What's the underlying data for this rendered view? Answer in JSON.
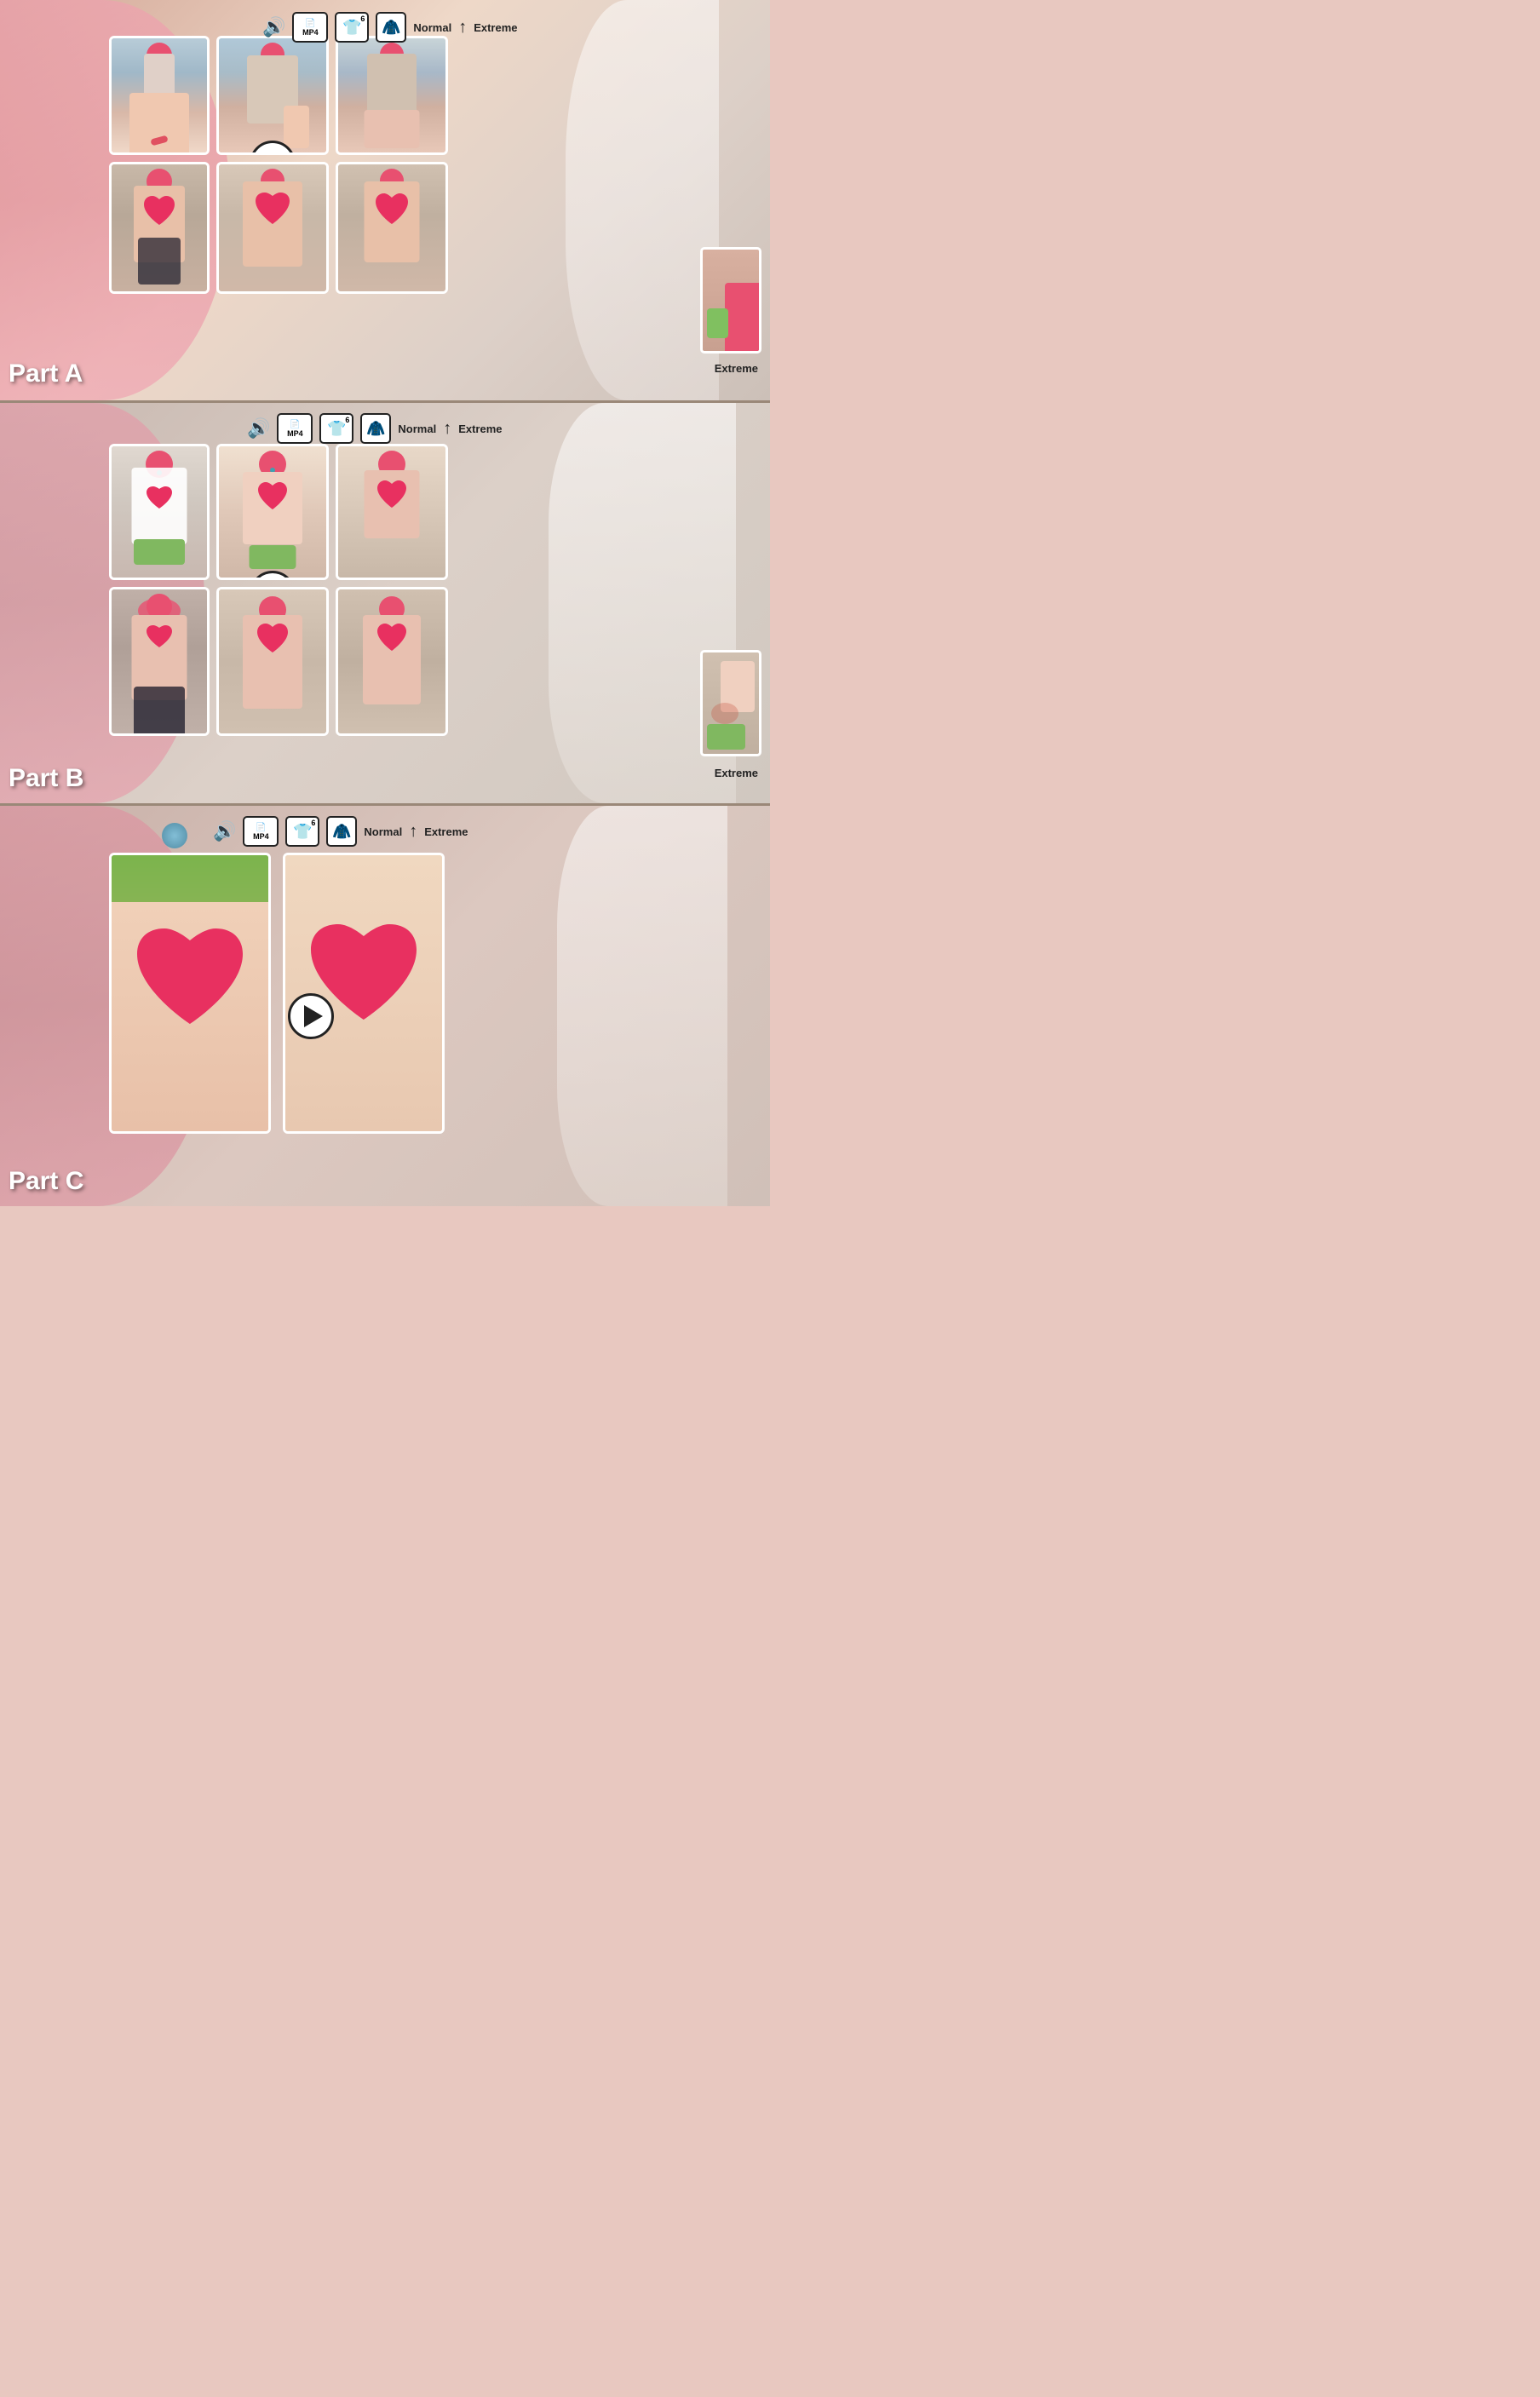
{
  "sections": [
    {
      "id": "part-a",
      "label": "Part A",
      "controls": {
        "sound_label": "🔊",
        "mp4_label": "MP4",
        "shirt_count": "6",
        "normal_label": "Normal",
        "extreme_label": "Extreme"
      },
      "extreme_label": "Extreme",
      "thumbnails": [
        {
          "id": "a-t1",
          "style": "normal"
        },
        {
          "id": "a-t2",
          "style": "normal-alt"
        },
        {
          "id": "a-t3",
          "style": "normal"
        },
        {
          "id": "a-t4",
          "style": "topless"
        },
        {
          "id": "a-t5",
          "style": "topless-alt"
        },
        {
          "id": "a-t6",
          "style": "topless"
        }
      ]
    },
    {
      "id": "part-b",
      "label": "Part B",
      "controls": {
        "sound_label": "🔊",
        "mp4_label": "MP4",
        "shirt_count": "6",
        "normal_label": "Normal",
        "extreme_label": "Extreme"
      },
      "extreme_label": "Extreme",
      "thumbnails": [
        {
          "id": "b-t1",
          "style": "close-normal"
        },
        {
          "id": "b-t2",
          "style": "close-top"
        },
        {
          "id": "b-t3",
          "style": "close-top"
        },
        {
          "id": "b-t4",
          "style": "close-laying"
        },
        {
          "id": "b-t5",
          "style": "close-laying-alt"
        },
        {
          "id": "b-t6",
          "style": "close-laying"
        }
      ]
    },
    {
      "id": "part-c",
      "label": "Part C",
      "controls": {
        "sound_label": "🔊",
        "mp4_label": "MP4",
        "shirt_count": "6",
        "normal_label": "Normal",
        "extreme_label": "Extreme"
      },
      "thumbnails": [
        {
          "id": "c-t1",
          "style": "closeup-1"
        },
        {
          "id": "c-t2",
          "style": "closeup-2"
        }
      ]
    }
  ]
}
